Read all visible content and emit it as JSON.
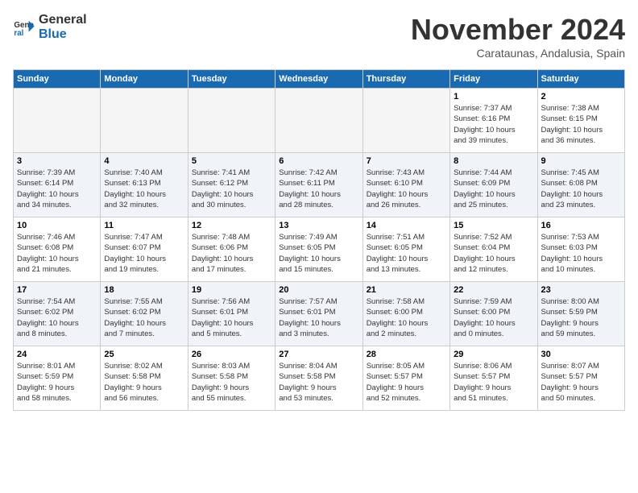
{
  "logo": {
    "line1": "General",
    "line2": "Blue"
  },
  "title": "November 2024",
  "subtitle": "Carataunas, Andalusia, Spain",
  "weekdays": [
    "Sunday",
    "Monday",
    "Tuesday",
    "Wednesday",
    "Thursday",
    "Friday",
    "Saturday"
  ],
  "weeks": [
    [
      {
        "day": "",
        "info": ""
      },
      {
        "day": "",
        "info": ""
      },
      {
        "day": "",
        "info": ""
      },
      {
        "day": "",
        "info": ""
      },
      {
        "day": "",
        "info": ""
      },
      {
        "day": "1",
        "info": "Sunrise: 7:37 AM\nSunset: 6:16 PM\nDaylight: 10 hours\nand 39 minutes."
      },
      {
        "day": "2",
        "info": "Sunrise: 7:38 AM\nSunset: 6:15 PM\nDaylight: 10 hours\nand 36 minutes."
      }
    ],
    [
      {
        "day": "3",
        "info": "Sunrise: 7:39 AM\nSunset: 6:14 PM\nDaylight: 10 hours\nand 34 minutes."
      },
      {
        "day": "4",
        "info": "Sunrise: 7:40 AM\nSunset: 6:13 PM\nDaylight: 10 hours\nand 32 minutes."
      },
      {
        "day": "5",
        "info": "Sunrise: 7:41 AM\nSunset: 6:12 PM\nDaylight: 10 hours\nand 30 minutes."
      },
      {
        "day": "6",
        "info": "Sunrise: 7:42 AM\nSunset: 6:11 PM\nDaylight: 10 hours\nand 28 minutes."
      },
      {
        "day": "7",
        "info": "Sunrise: 7:43 AM\nSunset: 6:10 PM\nDaylight: 10 hours\nand 26 minutes."
      },
      {
        "day": "8",
        "info": "Sunrise: 7:44 AM\nSunset: 6:09 PM\nDaylight: 10 hours\nand 25 minutes."
      },
      {
        "day": "9",
        "info": "Sunrise: 7:45 AM\nSunset: 6:08 PM\nDaylight: 10 hours\nand 23 minutes."
      }
    ],
    [
      {
        "day": "10",
        "info": "Sunrise: 7:46 AM\nSunset: 6:08 PM\nDaylight: 10 hours\nand 21 minutes."
      },
      {
        "day": "11",
        "info": "Sunrise: 7:47 AM\nSunset: 6:07 PM\nDaylight: 10 hours\nand 19 minutes."
      },
      {
        "day": "12",
        "info": "Sunrise: 7:48 AM\nSunset: 6:06 PM\nDaylight: 10 hours\nand 17 minutes."
      },
      {
        "day": "13",
        "info": "Sunrise: 7:49 AM\nSunset: 6:05 PM\nDaylight: 10 hours\nand 15 minutes."
      },
      {
        "day": "14",
        "info": "Sunrise: 7:51 AM\nSunset: 6:05 PM\nDaylight: 10 hours\nand 13 minutes."
      },
      {
        "day": "15",
        "info": "Sunrise: 7:52 AM\nSunset: 6:04 PM\nDaylight: 10 hours\nand 12 minutes."
      },
      {
        "day": "16",
        "info": "Sunrise: 7:53 AM\nSunset: 6:03 PM\nDaylight: 10 hours\nand 10 minutes."
      }
    ],
    [
      {
        "day": "17",
        "info": "Sunrise: 7:54 AM\nSunset: 6:02 PM\nDaylight: 10 hours\nand 8 minutes."
      },
      {
        "day": "18",
        "info": "Sunrise: 7:55 AM\nSunset: 6:02 PM\nDaylight: 10 hours\nand 7 minutes."
      },
      {
        "day": "19",
        "info": "Sunrise: 7:56 AM\nSunset: 6:01 PM\nDaylight: 10 hours\nand 5 minutes."
      },
      {
        "day": "20",
        "info": "Sunrise: 7:57 AM\nSunset: 6:01 PM\nDaylight: 10 hours\nand 3 minutes."
      },
      {
        "day": "21",
        "info": "Sunrise: 7:58 AM\nSunset: 6:00 PM\nDaylight: 10 hours\nand 2 minutes."
      },
      {
        "day": "22",
        "info": "Sunrise: 7:59 AM\nSunset: 6:00 PM\nDaylight: 10 hours\nand 0 minutes."
      },
      {
        "day": "23",
        "info": "Sunrise: 8:00 AM\nSunset: 5:59 PM\nDaylight: 9 hours\nand 59 minutes."
      }
    ],
    [
      {
        "day": "24",
        "info": "Sunrise: 8:01 AM\nSunset: 5:59 PM\nDaylight: 9 hours\nand 58 minutes."
      },
      {
        "day": "25",
        "info": "Sunrise: 8:02 AM\nSunset: 5:58 PM\nDaylight: 9 hours\nand 56 minutes."
      },
      {
        "day": "26",
        "info": "Sunrise: 8:03 AM\nSunset: 5:58 PM\nDaylight: 9 hours\nand 55 minutes."
      },
      {
        "day": "27",
        "info": "Sunrise: 8:04 AM\nSunset: 5:58 PM\nDaylight: 9 hours\nand 53 minutes."
      },
      {
        "day": "28",
        "info": "Sunrise: 8:05 AM\nSunset: 5:57 PM\nDaylight: 9 hours\nand 52 minutes."
      },
      {
        "day": "29",
        "info": "Sunrise: 8:06 AM\nSunset: 5:57 PM\nDaylight: 9 hours\nand 51 minutes."
      },
      {
        "day": "30",
        "info": "Sunrise: 8:07 AM\nSunset: 5:57 PM\nDaylight: 9 hours\nand 50 minutes."
      }
    ]
  ]
}
